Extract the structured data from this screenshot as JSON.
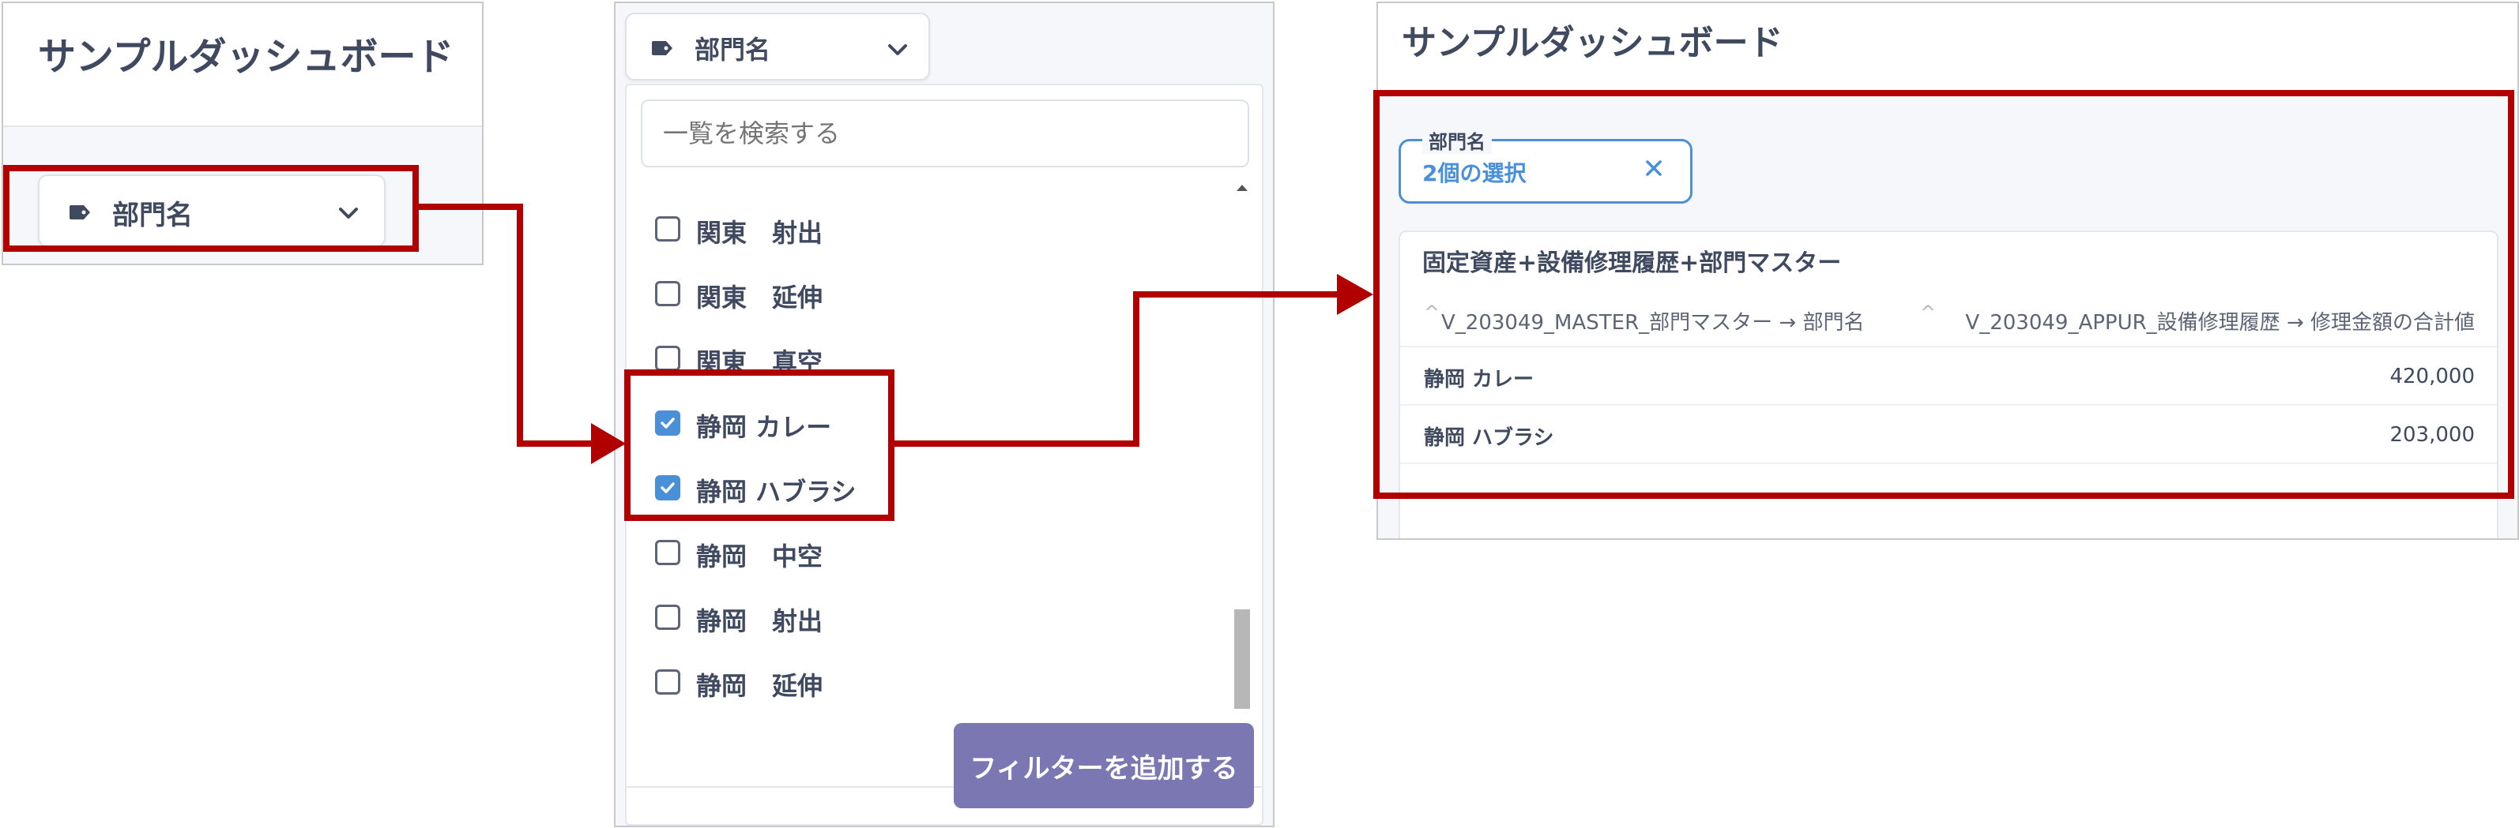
{
  "dashboard": {
    "title": "サンプルダッシュボード"
  },
  "filter_chip": {
    "label": "部門名"
  },
  "dropdown": {
    "search_placeholder": "一覧を検索する",
    "options": [
      {
        "label": "関東　射出",
        "checked": false
      },
      {
        "label": "関東　延伸",
        "checked": false
      },
      {
        "label": "関東　真空",
        "checked": false
      },
      {
        "label": "静岡 カレー",
        "checked": true
      },
      {
        "label": "静岡 ハブラシ",
        "checked": true
      },
      {
        "label": "静岡　中空",
        "checked": false
      },
      {
        "label": "静岡　射出",
        "checked": false
      },
      {
        "label": "静岡　延伸",
        "checked": false
      }
    ],
    "add_button": "フィルターを追加する"
  },
  "applied_filter": {
    "label": "部門名",
    "value": "2個の選択"
  },
  "result_table": {
    "title": "固定資産+設備修理履歴+部門マスター",
    "columns": [
      "V_203049_MASTER_部門マスター → 部門名",
      "V_203049_APPUR_設備修理履歴 → 修理金額の合計値"
    ],
    "rows": [
      {
        "name": "静岡 カレー",
        "value": "420,000"
      },
      {
        "name": "静岡 ハブラシ",
        "value": "203,000"
      }
    ]
  },
  "colors": {
    "highlight": "#b00000",
    "accent": "#4a90d9",
    "button": "#7a77b3"
  },
  "icons": [
    "tag-icon",
    "chevron-down-icon",
    "checkbox-checked-icon",
    "close-icon",
    "sort-caret-icon",
    "scroll-up-icon",
    "scroll-down-icon"
  ]
}
